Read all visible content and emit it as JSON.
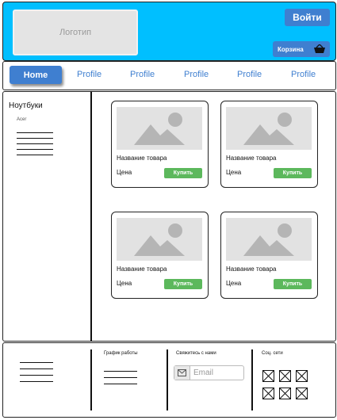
{
  "header": {
    "logo_text": "Логотип",
    "login_label": "Войти",
    "cart_label": "Корзина",
    "cart_icon": "basket-icon",
    "background_color": "#00bfff",
    "button_color": "#3f7fd0"
  },
  "nav": {
    "home_label": "Home",
    "items": [
      "Profile",
      "Profile",
      "Profile",
      "Profile",
      "Profile"
    ]
  },
  "sidebar": {
    "category_title": "Ноутбуки",
    "subcategory": "Acer"
  },
  "products": [
    {
      "name": "Название товара",
      "price": "Цена",
      "buy_label": "Купить",
      "image_icon": "image-placeholder-icon"
    },
    {
      "name": "Название товара",
      "price": "Цена",
      "buy_label": "Купить",
      "image_icon": "image-placeholder-icon"
    },
    {
      "name": "Название товара",
      "price": "Цена",
      "buy_label": "Купить",
      "image_icon": "image-placeholder-icon"
    },
    {
      "name": "Название товара",
      "price": "Цена",
      "buy_label": "Купить",
      "image_icon": "image-placeholder-icon"
    }
  ],
  "footer": {
    "schedule_title": "График работы",
    "contact_title": "Свяжитесь с нами",
    "email_placeholder": "Email",
    "social_title": "Соц. сети",
    "social_icons": [
      "social-icon",
      "social-icon",
      "social-icon",
      "social-icon",
      "social-icon",
      "social-icon"
    ]
  },
  "buy_color": "#5cb85c"
}
